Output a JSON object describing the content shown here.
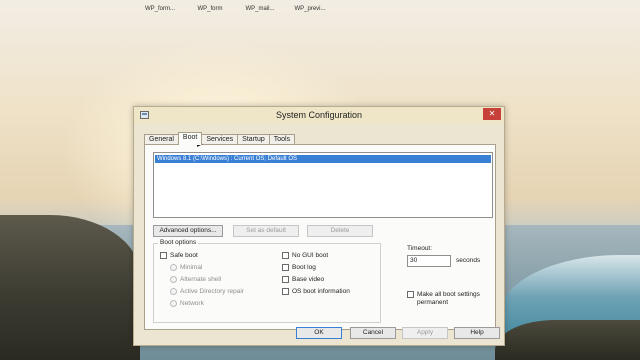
{
  "desktop": {
    "icons": [
      {
        "label": "WP_form...",
        "icon": "file-icon"
      },
      {
        "label": "WP_form",
        "icon": "file-icon"
      },
      {
        "label": "WP_mail...",
        "icon": "file-icon"
      },
      {
        "label": "WP_previ...",
        "icon": "file-icon"
      }
    ]
  },
  "window": {
    "title": "System Configuration",
    "close_glyph": "✕"
  },
  "tabs": [
    "General",
    "Boot",
    "Services",
    "Startup",
    "Tools"
  ],
  "active_tab": "Boot",
  "boot_list": {
    "items": [
      "Windows 8.1 (C:\\Windows) : Current OS; Default OS"
    ]
  },
  "buttons": {
    "advanced": "Advanced options...",
    "set_default": "Set as default",
    "delete": "Delete"
  },
  "boot_options": {
    "title": "Boot options",
    "safe_boot": "Safe boot",
    "radios": [
      "Minimal",
      "Alternate shell",
      "Active Directory repair",
      "Network"
    ],
    "checks": [
      "No GUI boot",
      "Boot log",
      "Base video",
      "OS boot information"
    ]
  },
  "timeout": {
    "label": "Timeout:",
    "value": "30",
    "unit": "seconds"
  },
  "permanent": {
    "label_line1": "Make all boot settings",
    "label_line2": "permanent"
  },
  "footer": {
    "ok": "OK",
    "cancel": "Cancel",
    "apply": "Apply",
    "help": "Help"
  }
}
